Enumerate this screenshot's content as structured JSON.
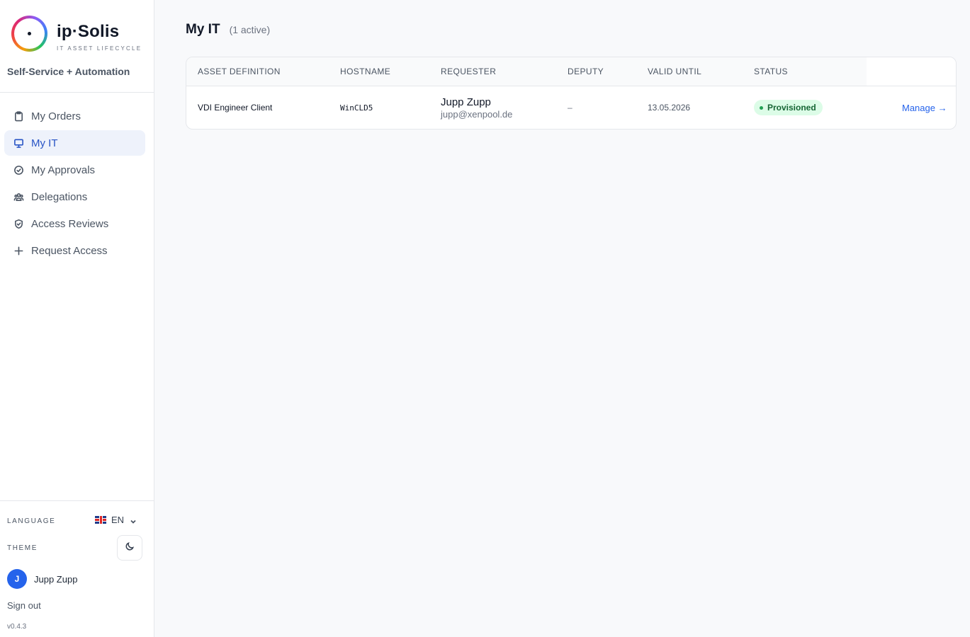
{
  "brand": {
    "name": "ip·Solis",
    "tagline": "IT ASSET LIFECYCLE",
    "subtitle": "Self-Service + Automation"
  },
  "nav": [
    {
      "label": "My Orders",
      "icon": "clipboard-icon",
      "active": false
    },
    {
      "label": "My IT",
      "icon": "monitor-icon",
      "active": true
    },
    {
      "label": "My Approvals",
      "icon": "check-circle-icon",
      "active": false
    },
    {
      "label": "Delegations",
      "icon": "users-icon",
      "active": false
    },
    {
      "label": "Access Reviews",
      "icon": "shield-check-icon",
      "active": false
    },
    {
      "label": "Request Access",
      "icon": "plus-icon",
      "active": false
    }
  ],
  "settings": {
    "language_label": "LANGUAGE",
    "language_value": "EN",
    "theme_label": "THEME"
  },
  "user": {
    "initial": "J",
    "name": "Jupp Zupp",
    "sign_out": "Sign out",
    "version": "v0.4.3"
  },
  "page": {
    "title": "My IT",
    "count": "(1 active)"
  },
  "table": {
    "columns": [
      "ASSET DEFINITION",
      "HOSTNAME",
      "REQUESTER",
      "DEPUTY",
      "VALID UNTIL",
      "STATUS"
    ],
    "rows": [
      {
        "asset_definition": "VDI Engineer Client",
        "hostname": "WinCLD5",
        "requester_name": "Jupp Zupp",
        "requester_email": "jupp@xenpool.de",
        "deputy": "–",
        "valid_until": "13.05.2026",
        "status": "Provisioned",
        "action": "Manage →"
      }
    ]
  },
  "colors": {
    "accent": "#2563eb",
    "active_nav_bg": "#eef2fb",
    "status_bg": "#dcfce7",
    "status_text": "#166534"
  }
}
